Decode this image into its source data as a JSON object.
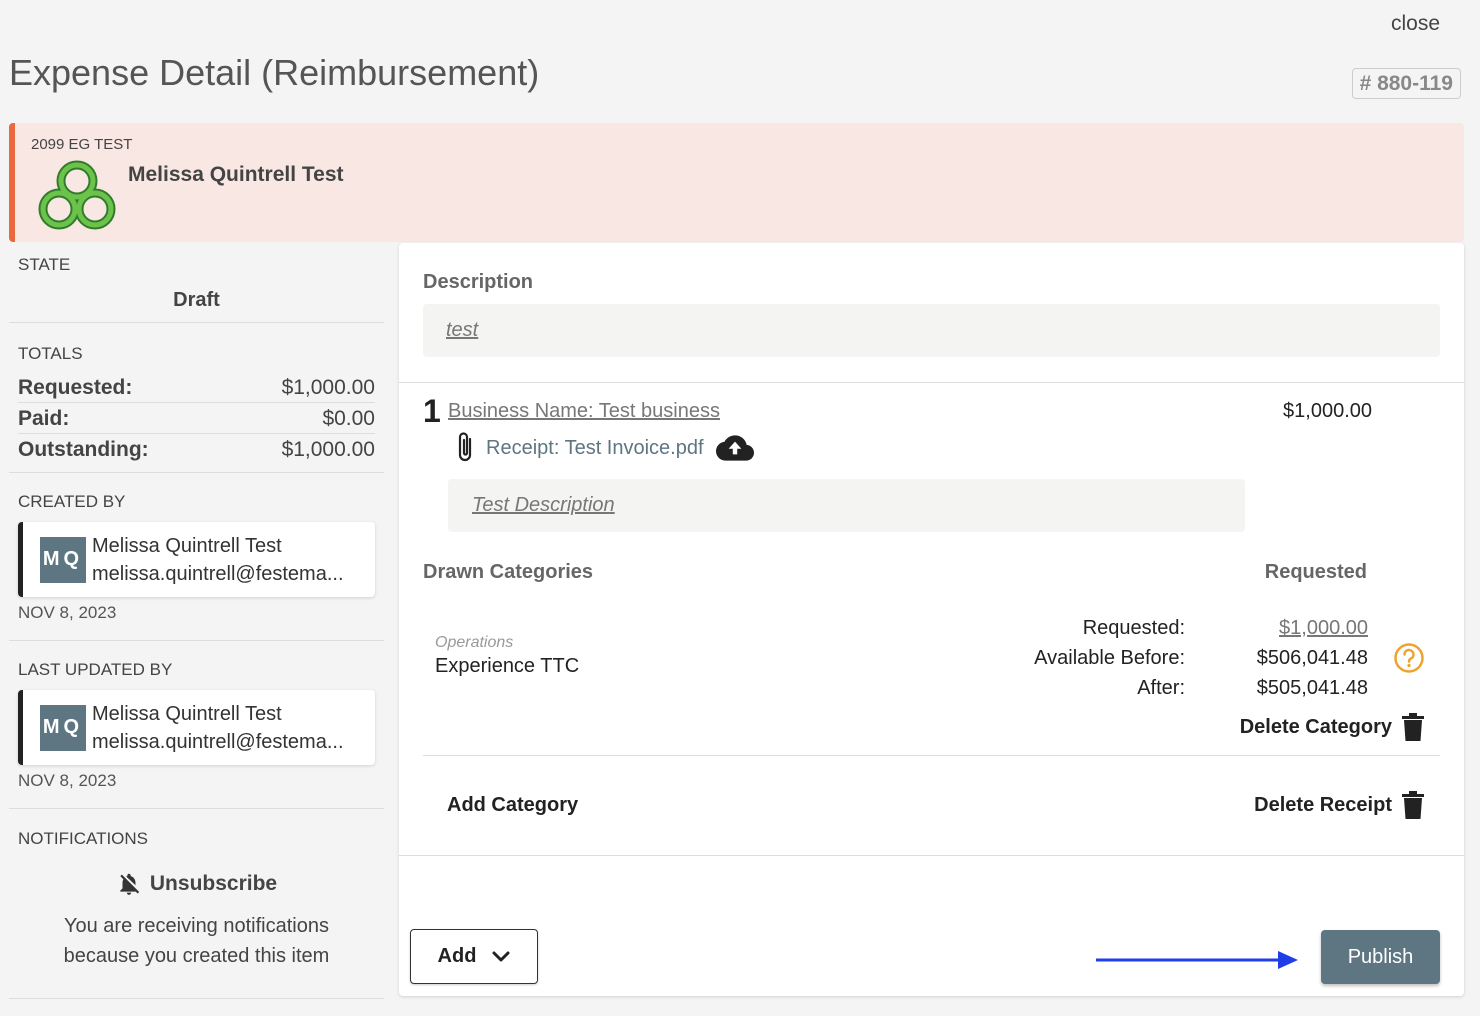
{
  "header": {
    "close_label": "close",
    "title": "Expense Detail (Reimbursement)",
    "ref_number": "# 880-119"
  },
  "org": {
    "code": "2099 EG TEST",
    "name": "Melissa Quintrell Test",
    "logo_icon": "trefoil-logo-icon",
    "accent_color": "#e8683f",
    "banner_color": "#f8e7e3"
  },
  "sidebar": {
    "state": {
      "heading": "STATE",
      "value": "Draft"
    },
    "totals": {
      "heading": "TOTALS",
      "rows": [
        {
          "label": "Requested:",
          "value": "$1,000.00"
        },
        {
          "label": "Paid:",
          "value": "$0.00"
        },
        {
          "label": "Outstanding:",
          "value": "$1,000.00"
        }
      ]
    },
    "created_by": {
      "heading": "CREATED BY",
      "initials": "MQ",
      "name": "Melissa Quintrell Test",
      "email": "melissa.quintrell@festema...",
      "date": "NOV 8, 2023"
    },
    "last_updated_by": {
      "heading": "LAST UPDATED BY",
      "initials": "MQ",
      "name": "Melissa Quintrell Test",
      "email": "melissa.quintrell@festema...",
      "date": "NOV 8, 2023"
    },
    "notifications": {
      "heading": "NOTIFICATIONS",
      "unsubscribe_label": "Unsubscribe",
      "line1": "You are receiving notifications",
      "line2": "because you created this item"
    }
  },
  "main": {
    "description_label": "Description",
    "description_value": "test",
    "item": {
      "number": "1",
      "business_name": "Business Name: Test business",
      "amount": "$1,000.00",
      "receipt": "Receipt: Test Invoice.pdf",
      "description": "Test Description"
    },
    "drawn_categories_label": "Drawn Categories",
    "requested_header": "Requested",
    "category": {
      "parent": "Operations",
      "name": "Experience TTC",
      "stats": [
        {
          "label": "Requested:",
          "value": "$1,000.00"
        },
        {
          "label": "Available Before:",
          "value": "$506,041.48"
        },
        {
          "label": "After:",
          "value": "$505,041.48"
        }
      ],
      "delete_label": "Delete Category"
    },
    "add_category_label": "Add Category",
    "delete_receipt_label": "Delete Receipt",
    "add_button_label": "Add",
    "publish_button_label": "Publish"
  },
  "colors": {
    "primary_button": "#5e7582",
    "help_icon": "#f0a22e",
    "annotation_arrow": "#1f3ee8"
  }
}
